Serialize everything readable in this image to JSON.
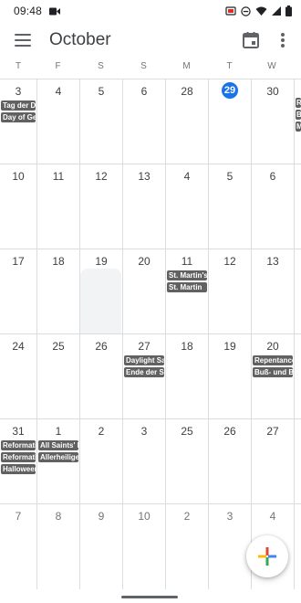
{
  "status_bar": {
    "time": "09:48"
  },
  "header": {
    "title": "October"
  },
  "weekdays": [
    "T",
    "F",
    "S",
    "S",
    "M",
    "T",
    "W"
  ],
  "weeks": [
    {
      "days": [
        {
          "num": "3",
          "events": [
            "Tag der Deutschen Einheit",
            "Day of German Unity"
          ]
        },
        {
          "num": "4",
          "events": []
        },
        {
          "num": "5",
          "events": []
        },
        {
          "num": "6",
          "events": []
        },
        {
          "num": "28",
          "events": []
        },
        {
          "num": "29",
          "events": []
        },
        {
          "num": "30",
          "events": []
        }
      ]
    },
    {
      "days": [
        {
          "num": "10",
          "events": []
        },
        {
          "num": "11",
          "events": []
        },
        {
          "num": "12",
          "events": []
        },
        {
          "num": "13",
          "events": []
        },
        {
          "num": "4",
          "events": []
        },
        {
          "num": "5",
          "events": []
        },
        {
          "num": "6",
          "events": []
        }
      ]
    },
    {
      "days": [
        {
          "num": "17",
          "events": []
        },
        {
          "num": "18",
          "events": []
        },
        {
          "num": "19",
          "events": []
        },
        {
          "num": "20",
          "events": []
        },
        {
          "num": "11",
          "events": [
            "St. Martin's Day",
            "St. Martin"
          ]
        },
        {
          "num": "12",
          "events": []
        },
        {
          "num": "13",
          "events": []
        }
      ]
    },
    {
      "days": [
        {
          "num": "24",
          "events": []
        },
        {
          "num": "25",
          "events": []
        },
        {
          "num": "26",
          "events": []
        },
        {
          "num": "27",
          "events": [
            "Daylight Saving Time ends",
            "Ende der Sommerzeit"
          ]
        },
        {
          "num": "18",
          "events": []
        },
        {
          "num": "19",
          "events": []
        },
        {
          "num": "20",
          "events": [
            "Repentance Day",
            "Buß- und Bettag"
          ]
        }
      ]
    },
    {
      "days": [
        {
          "num": "31",
          "events": [
            "Reformation Day",
            "Reformationstag",
            "Halloween"
          ]
        },
        {
          "num": "1",
          "events": [
            "All Saints' Day",
            "Allerheiligen"
          ]
        },
        {
          "num": "2",
          "events": []
        },
        {
          "num": "3",
          "events": []
        },
        {
          "num": "25",
          "events": []
        },
        {
          "num": "26",
          "events": []
        },
        {
          "num": "27",
          "events": []
        }
      ]
    },
    {
      "days": [
        {
          "num": "7",
          "events": []
        },
        {
          "num": "8",
          "events": []
        },
        {
          "num": "9",
          "events": []
        },
        {
          "num": "10",
          "events": []
        },
        {
          "num": "2",
          "events": []
        },
        {
          "num": "3",
          "events": []
        },
        {
          "num": "4",
          "events": []
        }
      ]
    }
  ],
  "overflow_events": [
    "R",
    "B",
    "M"
  ],
  "today": {
    "week": 0,
    "day": 5
  },
  "colors": {
    "accent": "#1a73e8",
    "chip": "#616161",
    "grid": "#dadce0",
    "selected_shade": "#f1f3f4"
  },
  "icons": [
    "video-camera-icon",
    "cast-icon",
    "do-not-disturb-icon",
    "wifi-icon",
    "cell-signal-icon",
    "battery-icon",
    "menu-icon",
    "today-calendar-icon",
    "more-vert-icon",
    "add-plus-icon"
  ]
}
